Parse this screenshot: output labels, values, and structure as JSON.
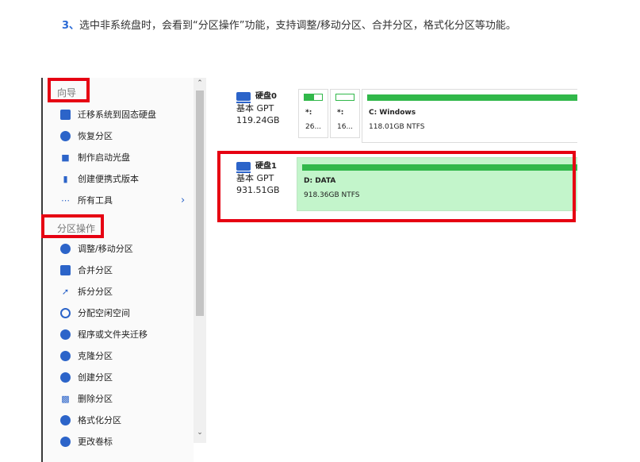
{
  "paragraph": {
    "step": "3、",
    "text": "选中非系统盘时，会看到“分区操作”功能，支持调整/移动分区、合并分区，格式化分区等功能。"
  },
  "sidebar": {
    "section1_title": "向导",
    "section1_items": [
      {
        "label": "迁移系统到固态硬盘",
        "icon": "migrate-disk-icon"
      },
      {
        "label": "恢复分区",
        "icon": "recover-partition-icon"
      },
      {
        "label": "制作启动光盘",
        "icon": "boot-disc-icon"
      },
      {
        "label": "创建便携式版本",
        "icon": "portable-icon"
      },
      {
        "label": "所有工具",
        "icon": "more-dots-icon"
      }
    ],
    "section2_title": "分区操作",
    "section2_items": [
      {
        "label": "调整/移动分区",
        "icon": "resize-icon"
      },
      {
        "label": "合并分区",
        "icon": "merge-icon"
      },
      {
        "label": "拆分分区",
        "icon": "split-icon"
      },
      {
        "label": "分配空闲空间",
        "icon": "allocate-icon"
      },
      {
        "label": "程序或文件夹迁移",
        "icon": "app-migrate-icon"
      },
      {
        "label": "克隆分区",
        "icon": "clone-icon"
      },
      {
        "label": "创建分区",
        "icon": "create-icon"
      },
      {
        "label": "删除分区",
        "icon": "delete-icon"
      },
      {
        "label": "格式化分区",
        "icon": "format-icon"
      },
      {
        "label": "更改卷标",
        "icon": "label-icon"
      }
    ],
    "more_chevron": "›"
  },
  "disks": [
    {
      "name": "硬盘0",
      "type": "基本 GPT",
      "size": "119.24GB",
      "partitions": [
        {
          "label": "*:",
          "sub": "26...",
          "usage": 0.55
        },
        {
          "label": "*:",
          "sub": "16...",
          "usage": 0.0
        },
        {
          "label": "C: Windows",
          "sub": "118.01GB NTFS",
          "usage": 1.0
        }
      ]
    },
    {
      "name": "硬盘1",
      "type": "基本 GPT",
      "size": "931.51GB",
      "partitions": [
        {
          "label": "D: DATA",
          "sub": "918.36GB NTFS",
          "usage": 1.0
        }
      ]
    }
  ],
  "colors": {
    "accent": "#2c64c9",
    "highlight": "#e60012",
    "usage_bar": "#31b84a",
    "selected_partition": "#c3f5cb"
  }
}
